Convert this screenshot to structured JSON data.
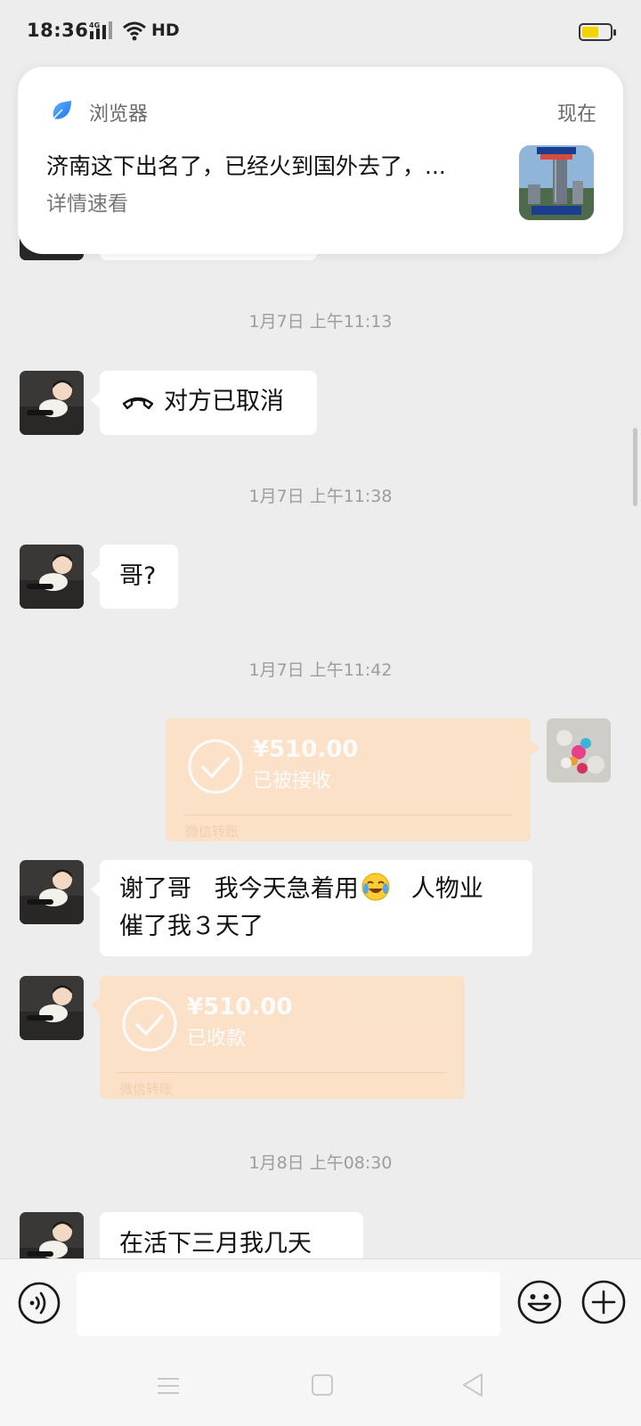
{
  "status_bar": {
    "time": "18:36",
    "network": "4G",
    "hd": "HD",
    "battery_level": 0.6,
    "battery_color": "#f4d400"
  },
  "notification": {
    "app_name": "浏览器",
    "time": "现在",
    "title": "济南这下出名了，已经火到国外去了，...",
    "body": "详情速看",
    "app_icon": "browser-icon"
  },
  "chat": {
    "timestamps": [
      "1月7日 上午11:13",
      "1月7日 上午11:38",
      "1月7日 上午11:42",
      "1月8日 上午08:30"
    ],
    "call_message": "对方已取消",
    "message_ge": "哥?",
    "transfer_sent": {
      "amount": "¥510.00",
      "status": "已被接收",
      "footer": "微信转账"
    },
    "message_thanks_part1": "谢了哥   我今天急着用",
    "message_thanks_part2": "  人物业",
    "message_thanks_line2": "催了我３天了",
    "transfer_received": {
      "amount": "¥510.00",
      "status": "已收款",
      "footer": "微信转账"
    },
    "partial_message": "在活下三月我几天"
  },
  "input_bar": {
    "placeholder": "",
    "voice_icon": "voice-icon",
    "emoji_icon": "emoji-icon",
    "plus_icon": "plus-icon"
  },
  "colors": {
    "chat_background": "#ededed",
    "transfer_bubble": "#fddfbf",
    "bubble_white": "#ffffff"
  }
}
